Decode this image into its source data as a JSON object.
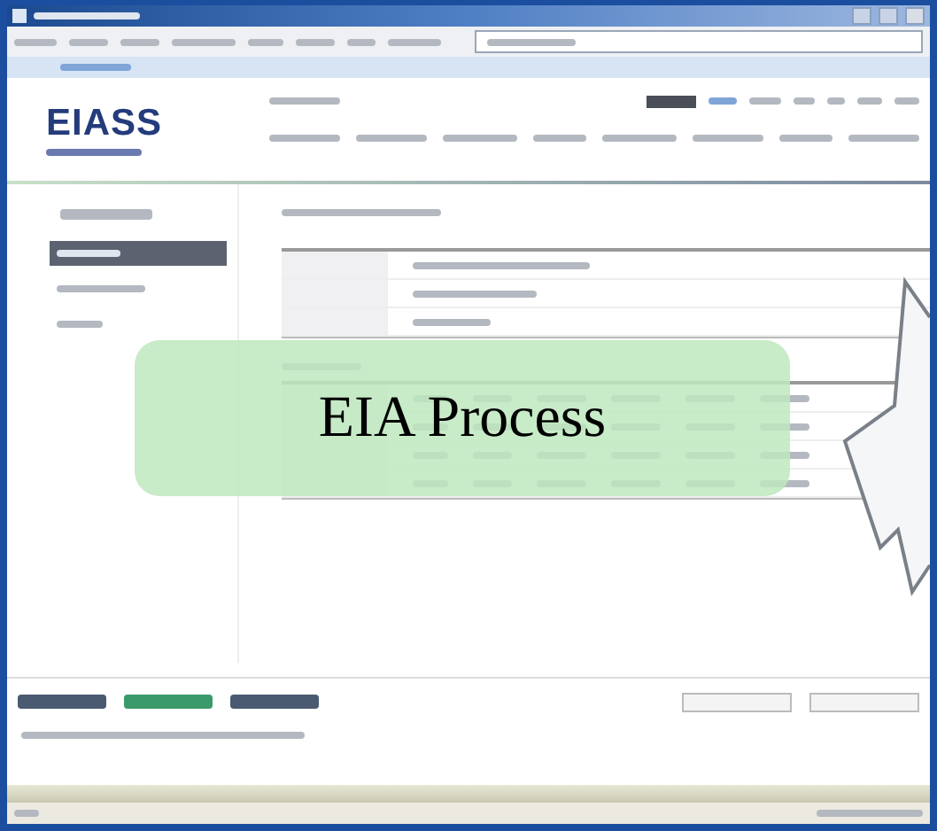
{
  "logo": {
    "text": "EIASS"
  },
  "sidebar": {
    "items": [
      {
        "selected": true
      },
      {
        "selected": false
      },
      {
        "selected": false
      }
    ]
  },
  "overlay": {
    "text": "EIA Process"
  }
}
